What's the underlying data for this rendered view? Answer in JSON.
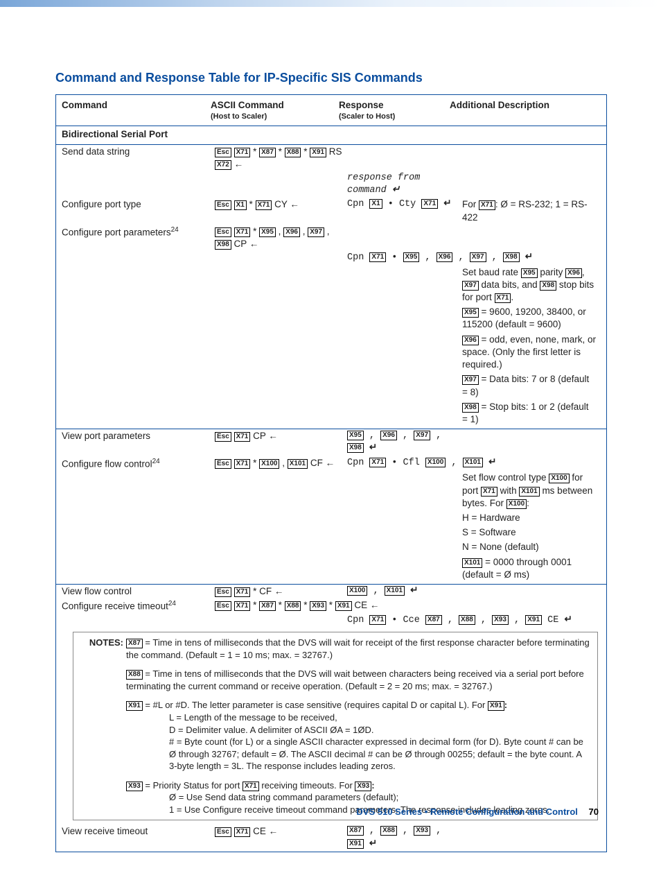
{
  "title": "Command and Response Table for IP-Specific SIS Commands",
  "hdr": {
    "c1": "Command",
    "c2": "ASCII Command",
    "c2s": "(Host to Scaler)",
    "c3": "Response",
    "c3s": "(Scaler to Host)",
    "c4": "Additional Description"
  },
  "sect1": "Bidirectional Serial Port",
  "r": {
    "send": {
      "label": "Send data string",
      "resp": "response from command"
    },
    "ptype": {
      "label": "Configure port type",
      "desc_pre": "For ",
      "desc_post": ": Ø = RS-232; 1 = RS-422"
    },
    "pparam": {
      "label": "Configure port parameters",
      "sup": "24",
      "d": [
        "Set baud rate ",
        " parity ",
        ", ",
        " data bits, and ",
        " stop bits for port ",
        " = 9600, 19200, 38400, or 115200 (default = 9600)",
        " = odd, even, none, mark, or space. (Only the first letter is required.)",
        " = Data bits: 7 or 8 (default = 8)",
        " = Stop bits: 1 or 2 (default = 1)"
      ]
    },
    "vparam": {
      "label": "View port parameters"
    },
    "flow": {
      "label": "Configure flow control",
      "sup": "24",
      "d": [
        "Set flow control type ",
        " for port ",
        " with ",
        " ms between bytes. For ",
        "H = Hardware",
        "S = Software",
        "N = None (default)",
        " = 0000 through 0001 (default = Ø ms)"
      ]
    },
    "vflow": {
      "label": "View flow control"
    },
    "rto": {
      "label": "Configure receive timeout",
      "sup": "24"
    },
    "vrto": {
      "label": "View receive timeout"
    }
  },
  "sym": {
    "esc": "Esc",
    "x1": "X1",
    "x71": "X71",
    "x72": "X72",
    "x87": "X87",
    "x88": "X88",
    "x91": "X91",
    "x93": "X93",
    "x95": "X95",
    "x96": "X96",
    "x97": "X97",
    "x98": "X98",
    "x100": "X100",
    "x101": "X101",
    "star": " * ",
    "cy": " CY",
    "cp": " CP",
    "rs": " RS",
    "cf": " CF",
    "ce": " CE",
    "cpn": "Cpn ",
    "cty": " • Cty ",
    "cfl": " • Cfl ",
    "bull": " • ",
    "cce": " • Cce ",
    "comma": " , "
  },
  "notes": {
    "lead": "NOTES:",
    "n87": " = Time in tens of milliseconds that the DVS will wait for receipt of the first response character before terminating the command. (Default = 1 = 10 ms; max. = 32767.)",
    "n88": " = Time in tens of milliseconds that the DVS will wait between characters being received via a serial port before terminating the current command or receive operation. (Default = 2 = 20 ms; max. = 32767.)",
    "n91a": " = #L or #D. The letter parameter is case sensitive (requires capital D or capital L). For ",
    "n91b": ":",
    "n91c": "L = Length of the message to be received,",
    "n91d": "D = Delimiter value. A delimiter of ASCII ØA = 1ØD.",
    "n91e": "# = Byte count (for L) or a single ASCII character expressed in decimal form (for D). Byte count # can be Ø through 32767; default = Ø. The ASCII decimal # can be Ø through 00255; default = the byte count. A 3-byte length = 3L. The response includes leading zeros.",
    "n93a": " = Priority Status for port ",
    "n93b": " receiving timeouts. For ",
    "n93c": ":",
    "n93d": "Ø = Use Send data string command parameters (default);",
    "n93e": "1 = Use Configure receive timeout command parameters. The response includes leading zeros."
  },
  "footer": {
    "title": "DVS 510 Series • Remote Configuration and Control",
    "page": "70"
  }
}
